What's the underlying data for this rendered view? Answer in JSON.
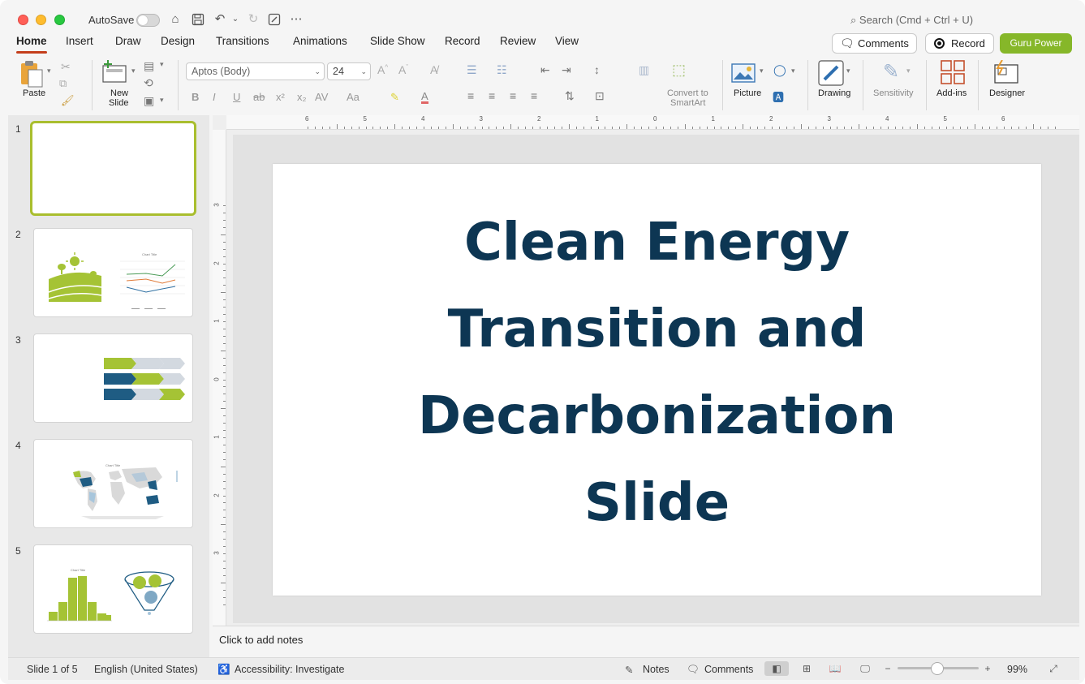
{
  "titlebar": {
    "autosave_label": "AutoSave",
    "autosave_on": false,
    "search_placeholder": "Search (Cmd + Ctrl + U)"
  },
  "tabs": [
    {
      "label": "Home",
      "active": true
    },
    {
      "label": "Insert"
    },
    {
      "label": "Draw"
    },
    {
      "label": "Design"
    },
    {
      "label": "Transitions"
    },
    {
      "label": "Animations"
    },
    {
      "label": "Slide Show"
    },
    {
      "label": "Record"
    },
    {
      "label": "Review"
    },
    {
      "label": "View"
    }
  ],
  "header_buttons": {
    "comments": "Comments",
    "record": "Record",
    "guru": "Guru Power"
  },
  "ribbon": {
    "paste": "Paste",
    "new_slide_1": "New",
    "new_slide_2": "Slide",
    "font_name": "Aptos (Body)",
    "font_size": "24",
    "convert_1": "Convert to",
    "convert_2": "SmartArt",
    "picture": "Picture",
    "drawing": "Drawing",
    "sensitivity": "Sensitivity",
    "addins": "Add-ins",
    "designer": "Designer"
  },
  "ruler": {
    "h_ticks": [
      "6",
      "5",
      "4",
      "3",
      "2",
      "1",
      "0",
      "1",
      "2",
      "3",
      "4",
      "5",
      "6"
    ],
    "v_ticks": [
      "3",
      "2",
      "1",
      "0",
      "1",
      "2",
      "3"
    ]
  },
  "thumbnails": [
    {
      "num": "1",
      "kind": "blank"
    },
    {
      "num": "2",
      "kind": "chart-landscape",
      "chart_title": "Chart Title"
    },
    {
      "num": "3",
      "kind": "arrows"
    },
    {
      "num": "4",
      "kind": "map",
      "chart_title": "Chart Title"
    },
    {
      "num": "5",
      "kind": "histogram",
      "chart_title": "Chart Title"
    }
  ],
  "slide": {
    "title_lines": [
      "Clean Energy",
      "Transition and",
      "Decarbonization",
      "Slide"
    ]
  },
  "notes_placeholder": "Click to add notes",
  "status": {
    "slide_info": "Slide 1 of 5",
    "language": "English (United States)",
    "accessibility": "Accessibility: Investigate",
    "notes": "Notes",
    "comments": "Comments",
    "zoom": "99%"
  },
  "colors": {
    "title": "#0d3653",
    "accent_green": "#86b729",
    "selection": "#a9be2e"
  }
}
